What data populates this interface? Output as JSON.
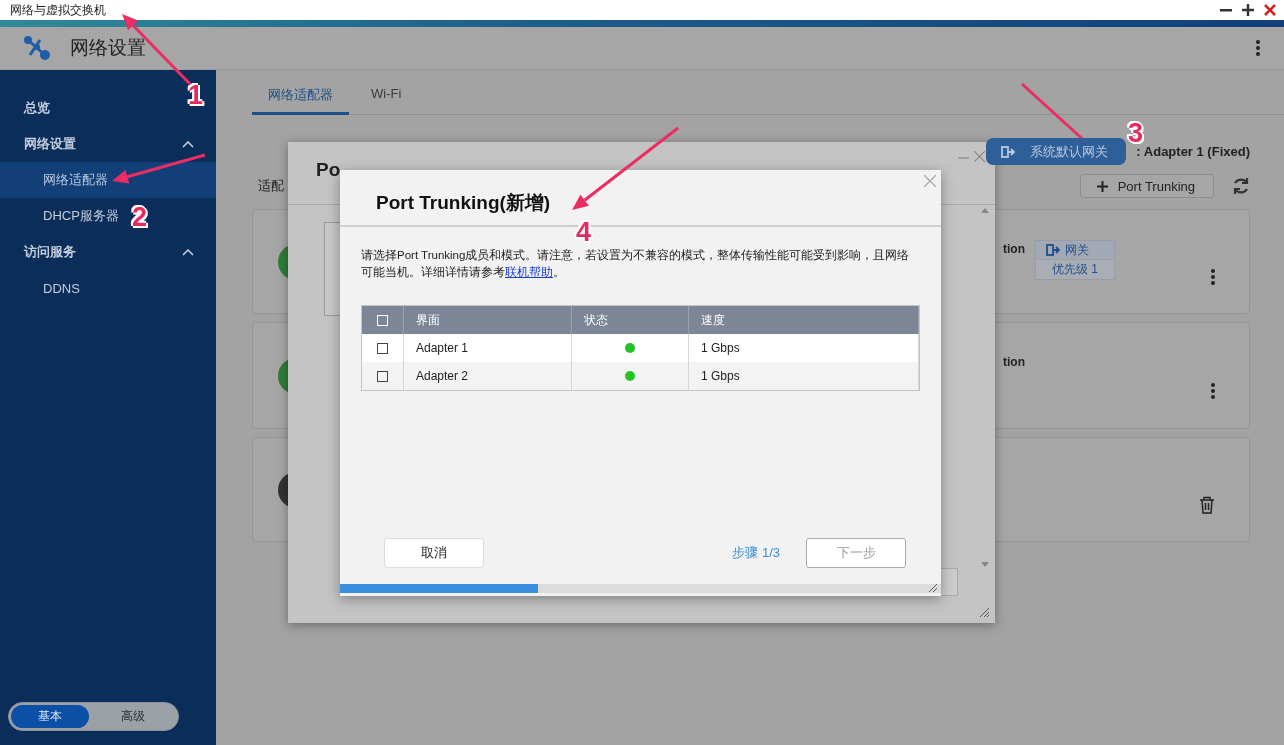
{
  "window": {
    "title": "网络与虚拟交换机"
  },
  "app": {
    "title": "网络设置"
  },
  "sidebar": {
    "items": [
      {
        "label": "总览",
        "kind": "item",
        "selected": false
      },
      {
        "label": "网络设置",
        "kind": "group",
        "expanded": true,
        "children": [
          {
            "label": "网络适配器",
            "selected": true
          },
          {
            "label": "DHCP服务器",
            "selected": false
          }
        ]
      },
      {
        "label": "访问服务",
        "kind": "group",
        "expanded": true,
        "children": [
          {
            "label": "DDNS",
            "selected": false
          }
        ]
      }
    ],
    "mode_switch": [
      {
        "label": "基本",
        "selected": true
      },
      {
        "label": "高级",
        "selected": false
      }
    ]
  },
  "tabs": [
    {
      "label": "网络适配器",
      "selected": true
    },
    {
      "label": "Wi-Fi",
      "selected": false
    }
  ],
  "section_label": "适配",
  "gateway_button": "系统默认网关",
  "gateway_value": ": Adapter 1 (Fixed)",
  "add_button": "Port Trunking",
  "adapter_cards": [
    {
      "kind": "menu",
      "text": "tion",
      "color": "#2f7d3a",
      "badge": {
        "title": "网关",
        "subtitle": "优先级 1"
      }
    },
    {
      "kind": "menu",
      "text": "tion",
      "color": "#2f7d3a"
    },
    {
      "kind": "trash",
      "color": "#333333"
    }
  ],
  "back_dialog": {
    "title": "Po"
  },
  "dialog": {
    "title": "Port Trunking(新增)",
    "description": {
      "text": "请选择Port Trunking成员和模式。请注意，若设置为不兼容的模式，整体传输性能可能受到影响，且网络可能当机。详细详情请参考",
      "link": "联机帮助",
      "tail": "。"
    },
    "table": {
      "header_checked": false,
      "columns": [
        "界面",
        "状态",
        "速度"
      ],
      "rows": [
        {
          "checked": false,
          "interface": "Adapter 1",
          "color": "#22c322",
          "speed": "1 Gbps"
        },
        {
          "checked": false,
          "interface": "Adapter 2",
          "color": "#22c322",
          "speed": "1 Gbps"
        }
      ]
    },
    "cancel_button": "取消",
    "step": "步骤 1/3",
    "next_button": {
      "label": "下一步",
      "disabled": true
    },
    "progress": {
      "level": 0.33
    }
  },
  "annotations": [
    {
      "label": "1"
    },
    {
      "label": "2"
    },
    {
      "label": "3"
    },
    {
      "label": "4"
    }
  ]
}
